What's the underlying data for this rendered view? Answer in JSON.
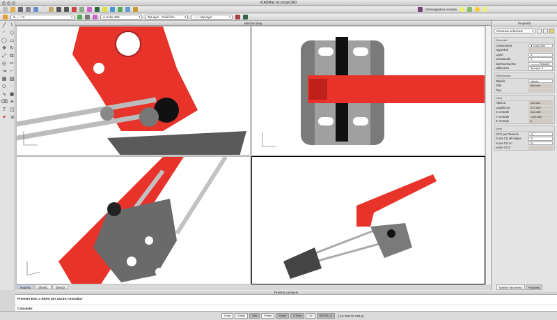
{
  "app": {
    "title": "iCADMac by progeCAD"
  },
  "toolbar": {
    "layer": "0",
    "color": "Color 250",
    "linetype_layer": "ByLayer",
    "linetype": "Solid line",
    "lineweight": "—— ByLayer",
    "shading_label": "Ombreggiatura Animata"
  },
  "document": {
    "title": "Mechs2.dwg"
  },
  "properties": {
    "title": "Proprietà",
    "selection": "Nessuna selezione",
    "generale": {
      "title": "Generale",
      "rows": [
        {
          "k": "ColoreLinea",
          "v": "● Color 250"
        },
        {
          "k": "Hyperlink",
          "v": ""
        },
        {
          "k": "Layer",
          "v": "0"
        },
        {
          "k": "LineaScala",
          "v": "1"
        },
        {
          "k": "SpessoreLinea",
          "v": "——— ByLayer"
        },
        {
          "k": "StileLinea",
          "v": "ByLayer   S"
        }
      ]
    },
    "stilestampa": {
      "title": "StileStampa",
      "rows": [
        {
          "k": "Tabella",
          "v": "Niente"
        },
        {
          "k": "Stile",
          "v": "ByColor"
        },
        {
          "k": "Tipo",
          "v": ""
        }
      ]
    },
    "vista": {
      "title": "Vista",
      "rows": [
        {
          "k": "Altezza",
          "v": "119.264"
        },
        {
          "k": "Larghezza",
          "v": "217.109"
        },
        {
          "k": "X centrale",
          "v": "142.495"
        },
        {
          "k": "Y centrale",
          "v": "-102.089"
        },
        {
          "k": "Z centrale",
          "v": "0"
        }
      ]
    },
    "varie": {
      "title": "Varie",
      "rows": [
        {
          "k": "CCS per Tessera",
          "v": "Sì"
        },
        {
          "k": "Icona CS all'origine",
          "v": "Sì"
        },
        {
          "k": "Icona CS on",
          "v": "Sì"
        },
        {
          "k": "nome CCS",
          "v": ""
        }
      ]
    },
    "tabs": [
      "Matrice Strumento",
      "Proprietà"
    ]
  },
  "layout_tabs": [
    "Modello",
    "Sheet1",
    "Sheet2"
  ],
  "command": {
    "title": "Finestra comando",
    "output": "Premere ESC o INVIO per uscire.<Annulla>",
    "prompt": "Comando:"
  },
  "status": {
    "buttons": [
      "Snap",
      "Griglia",
      "Orto",
      "Polare",
      "Snapif",
      "OTrack",
      "LW",
      "MODELLO"
    ],
    "active": [
      2,
      4,
      5,
      7
    ],
    "coords": "(-10.798,72.798,0)"
  },
  "colors": {
    "part_red": "#e8332a",
    "part_gray": "#6e6e6e"
  }
}
